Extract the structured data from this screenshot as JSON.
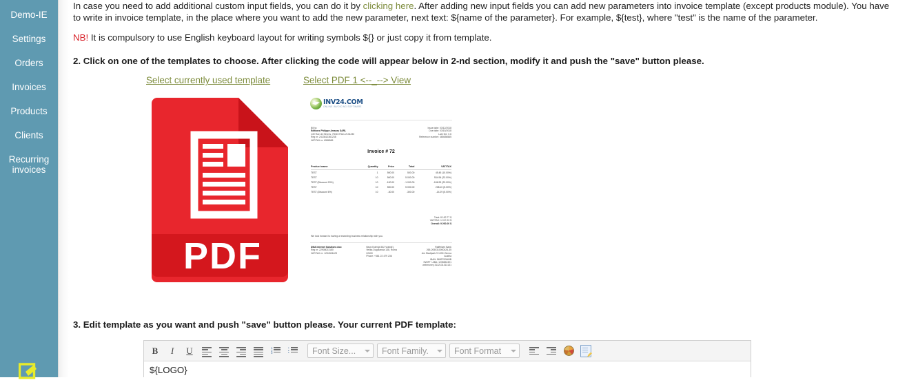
{
  "sidebar": {
    "items": [
      {
        "label": "Demo-IE",
        "name": "sidebar-item-demo-ie"
      },
      {
        "label": "Settings",
        "name": "sidebar-item-settings"
      },
      {
        "label": "Orders",
        "name": "sidebar-item-orders"
      },
      {
        "label": "Invoices",
        "name": "sidebar-item-invoices"
      },
      {
        "label": "Products",
        "name": "sidebar-item-products"
      },
      {
        "label": "Clients",
        "name": "sidebar-item-clients"
      },
      {
        "label": "Recurring invoices",
        "name": "sidebar-item-recurring-invoices"
      }
    ],
    "bottom_icon": "logout-icon"
  },
  "intro": {
    "part1": "In case you need to add additional custom input fields, you can do it by ",
    "link": "clicking here",
    "part2": ". After adding new input fields you can add new parameters into invoice template (except products module). You have to write in invoice template, in the place where you want to add the new parameter, next text: ${name of the parameter}. For example, ${test}, where \"test\" is the name of the parameter."
  },
  "nb": {
    "flag": "NB!",
    "text": " It is compulsory to use English keyboard layout for writing symbols ${} or just copy it from template."
  },
  "step2": {
    "heading": "2. Click on one of the templates to choose. After clicking the code will appear below in 2-nd section, modify it and push the \"save\" button please.",
    "label_current": "Select currently used template",
    "label_pdf1": "Select PDF 1 <--_--> View",
    "pdf_icon_text": "PDF"
  },
  "step3": {
    "heading": "3. Edit template as you want and push \"save\" button please. Your current PDF template:"
  },
  "editor": {
    "toolbar": {
      "bold": "B",
      "italic": "I",
      "underline": "U",
      "align_left": "align-left-icon",
      "align_center": "align-center-icon",
      "align_right": "align-right-icon",
      "align_justify": "align-justify-icon",
      "ordered_list": "ordered-list-icon",
      "unordered_list": "unordered-list-icon",
      "font_size": "Font Size...",
      "font_family": "Font Family.",
      "font_format": "Font Format",
      "outdent": "outdent-icon",
      "indent": "indent-icon",
      "color_palette": "color-palette-icon",
      "source_edit": "source-edit-icon"
    },
    "body_text": "${LOGO}"
  },
  "invoice_thumb": {
    "logo_text": "INV24.COM",
    "logo_sub": "ONLINE INVOICING SOFTWARE",
    "bill_to_label": "Bill to:",
    "bill_to": [
      "Editions Philippe Amaury SARL",
      "149 Rue de Sèvres, 75015 Paris 2131230",
      "Reg nr: 2423612361238",
      "VAT/TAX nr: 6586565"
    ],
    "meta": [
      "Issue date: 03/12/2018",
      "Due date: 03/15/2018",
      "Late fee: 0.6",
      "Reference number: 465656565"
    ],
    "title": "Invoice # 72",
    "columns": [
      "Product name",
      "Quantity",
      "Price",
      "Total",
      "VAT/TAX"
    ],
    "rows": [
      [
        "TEST",
        "1",
        "500.00",
        "500.00",
        "45.45 (10.00%)"
      ],
      [
        "TEST",
        "10",
        "500.00",
        "5 000.00",
        "934.96 (23.00%)"
      ],
      [
        "TEST (Discount 20%)",
        "10",
        "-100.00",
        "-1 000.00",
        "-186.99 (23.00%)"
      ],
      [
        "TEST",
        "10",
        "500.00",
        "5 000.00",
        "238.10 (5.00%)"
      ],
      [
        "TEST (Discount 6%)",
        "10",
        "-30.00",
        "-300.00",
        "-14.29 (5.00%)"
      ]
    ],
    "totals": [
      "Total: 8 182.77 $",
      "VAT/TAX: 1 017.23 $",
      "Overall: 9 200.00 $"
    ],
    "thanks": "We look forward to having a rewarding business relationship with you.",
    "footer_col1": [
      "DMA Internet Solutions doo",
      "Reg nr: 22908023180",
      "VAT/TAX nr: 1234324423"
    ],
    "footer_col2": [
      "Neva Kolenja 502 Vratnik'j,",
      "Velika Dugolancia 138, Ruma",
      "22400",
      "Phone: +381 22 479 236"
    ],
    "footer_col3": [
      "Raiffeisen Bank",
      "265-2050310000426-35",
      "Am Stadtpark 9 1030 Vienna",
      "Austria",
      "IBAN: 5699792669B",
      "SWIFT / ABA: 1235654321",
      "webmoney 3132131313131"
    ]
  },
  "colors": {
    "sidebar_bg": "#5f9ab1",
    "link_olive": "#7d8c3c",
    "alert_red": "#d8222a",
    "pdf_red": "#e21f26",
    "pdf_red_dark": "#c4161c"
  }
}
